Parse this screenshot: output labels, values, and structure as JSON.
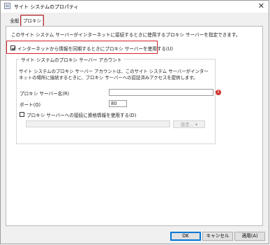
{
  "window": {
    "title": "サイト システムのプロパティ"
  },
  "tabs": [
    {
      "label": "全般"
    },
    {
      "label": "プロキシ"
    }
  ],
  "proxy": {
    "description": "このサイト システム サーバーがインターネットに接続するときに使用するプロキシ サーバーを指定できます。",
    "use_proxy_label": "インターネットから情報を同期するときにプロキシ サーバーを使用する(U)",
    "use_proxy_checked": true,
    "account_group": {
      "title": "サイト システムのプロキシ サーバー アカウント",
      "description": "サイト システムのプロキシ サーバー アカウントは、このサイト システム サーバーがインターネットの場所に接続するときに、プロキシ サーバーへの認証済みアクセスを提供します。"
    },
    "server_label": "プロキシ サーバー名(R)",
    "server_value": "",
    "port_label": "ポート(O)",
    "port_value": "80",
    "credentials_label": "プロキシ サーバーへの接続に資格情報を使用する(D)",
    "credentials_checked": false,
    "account_value": "",
    "settings_button": "設定..."
  },
  "buttons": {
    "ok": "OK",
    "cancel": "キャンセル",
    "apply": "適用(A)"
  },
  "colors": {
    "highlight": "#d7202a",
    "error": "#d0342c",
    "accent": "#0078d7"
  }
}
